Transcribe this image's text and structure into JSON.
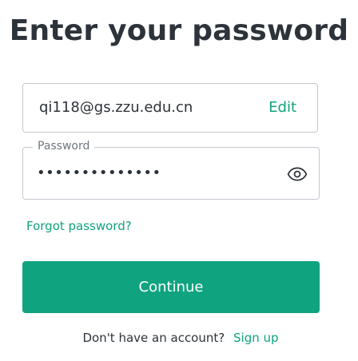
{
  "page": {
    "title": "Enter your password"
  },
  "email": {
    "value": "qi118@gs.zzu.edu.cn",
    "edit_label": "Edit"
  },
  "password": {
    "label": "Password",
    "masked_value": "••••••••••••••",
    "toggle_icon": "eye-icon"
  },
  "links": {
    "forgot_password": "Forgot password?"
  },
  "actions": {
    "continue_label": "Continue"
  },
  "signup": {
    "prompt": "Don't have an account?",
    "link_label": "Sign up"
  },
  "colors": {
    "accent": "#10a37f",
    "text": "#2d333a",
    "border": "#c2c8d0"
  }
}
